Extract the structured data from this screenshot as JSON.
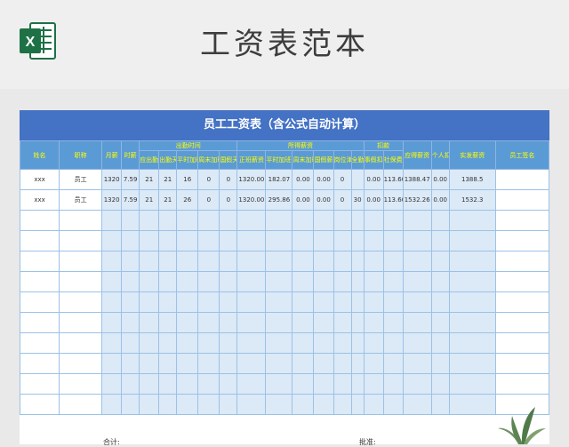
{
  "page": {
    "title": "工资表范本",
    "app_icon": "excel-icon",
    "accent_color": "#4472c4"
  },
  "sheet": {
    "banner": "员工工资表（含公式自动计算）",
    "headers": {
      "name": "姓名",
      "position": "职称",
      "monthly_salary": "月薪",
      "hourly_wage": "时薪",
      "attendance_group": "出勤时间",
      "due_days": "应出勤天数",
      "actual_days": "出勤天数",
      "weekday_overtime": "平时加班时数",
      "weekend_overtime": "周末加班时数",
      "holiday_days": "国假天数",
      "earned_group": "所得薪资",
      "regular_salary": "正班薪资",
      "weekday_overtime_pay": "平时加班薪资",
      "weekend_overtime_pay": "周末加班薪资",
      "holiday_pay": "国假薪资",
      "position_allowance": "岗位津贴",
      "full_attendance": "全勤奖",
      "deduction_group": "扣款",
      "leave_deduction": "事假扣款",
      "social_security": "社保费用",
      "gross_pay": "应得薪资",
      "income_tax": "个人扣税",
      "net_pay": "实发薪资",
      "signature": "员工签名"
    },
    "rows": [
      {
        "name": "xxx",
        "position": "员工",
        "monthly": "1320",
        "hourly": "7.59",
        "due": "21",
        "actual": "21",
        "weekday_ot": "16",
        "weekend_ot": "0",
        "holiday": "0",
        "regular": "1320.00",
        "weekday_pay": "182.07",
        "weekend_pay": "0.00",
        "holiday_pay": "0.00",
        "allowance": "0",
        "full": "",
        "leave": "0.00",
        "social": "113.60",
        "gross": "1388.47",
        "tax": "0.00",
        "net": "1388.5",
        "sign": ""
      },
      {
        "name": "xxx",
        "position": "员工",
        "monthly": "1320",
        "hourly": "7.59",
        "due": "21",
        "actual": "21",
        "weekday_ot": "26",
        "weekend_ot": "0",
        "holiday": "0",
        "regular": "1320.00",
        "weekday_pay": "295.86",
        "weekend_pay": "0.00",
        "holiday_pay": "0.00",
        "allowance": "0",
        "full": "30",
        "leave": "0.00",
        "social": "113.60",
        "gross": "1532.26",
        "tax": "0.00",
        "net": "1532.3",
        "sign": ""
      }
    ],
    "empty_rows": 10,
    "footer": {
      "total_label": "合计:",
      "approver_label": "批准:"
    }
  }
}
